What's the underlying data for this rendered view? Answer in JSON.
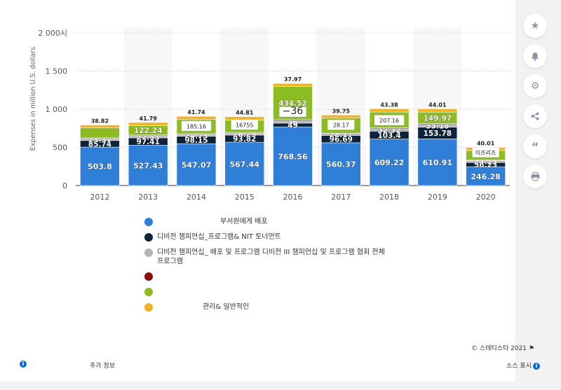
{
  "chart_data": {
    "type": "bar",
    "stacked": true,
    "ylabel": "Expenses in million U.S. dollars",
    "yticks": [
      "0",
      "500",
      "1 000",
      "1 500",
      "2 000시"
    ],
    "ylim": [
      0,
      2000
    ],
    "categories": [
      "2012",
      "2013",
      "2014",
      "2015",
      "2016",
      "2017",
      "2018",
      "2019",
      "2020"
    ],
    "series": [
      {
        "name": "부서원에게 배포",
        "color": "#2f7ed8",
        "values": [
          503.8,
          527.43,
          547.07,
          567.44,
          768.56,
          560.37,
          609.22,
          610.91,
          246.28
        ],
        "labels": [
          "503.8",
          "527.43",
          "547.07",
          "567.44",
          "768.56",
          "560.37",
          "609.22",
          "610.91",
          "246.28"
        ]
      },
      {
        "name": "디비전 챔피언십_프로그램& NIT 토너먼트",
        "color": "#0d233a",
        "values": [
          85.74,
          97.41,
          98.15,
          93.82,
          49,
          96.69,
          103.4,
          153.78,
          56.23
        ],
        "labels": [
          "85.74",
          "97.41",
          "98.15",
          "93.82",
          "49",
          "96.69",
          "103.4",
          "153.78",
          "56.23"
        ]
      },
      {
        "name": "디비전 챔피언십_ 배포 및 프로그램 디비전 III 챔피언십 및 프로그램 협회 전체 프로그램",
        "color": "#b5b5b5",
        "values": [
          25.37,
          27.53,
          24.73,
          26.29,
          36,
          28.17,
          32.32,
          35.18,
          24.23
        ],
        "labels": [
          "25.37",
          "27.53",
          "24.73",
          "26.29",
          "36",
          "28.17",
          "32.32",
          "35.18",
          "24.23"
        ]
      },
      {
        "name": "",
        "color": "#8b0e0e",
        "values": [
          10,
          10,
          10,
          10,
          12,
          10,
          11,
          12,
          8
        ],
        "labels": []
      },
      {
        "name": "",
        "color": "#8bbc21",
        "values": [
          130,
          122.24,
          185.16,
          160,
          434.52,
          188.9,
          207.16,
          149.97,
          125
        ],
        "labels": [
          "",
          "122.24",
          "",
          "",
          "434.52",
          "188.9",
          "",
          "149.97",
          ""
        ]
      },
      {
        "name": "관리& 일반적인",
        "color": "#f0b323",
        "values": [
          38.82,
          41.79,
          41.74,
          44.81,
          37.97,
          39.75,
          43.38,
          44.01,
          40.01
        ],
        "labels": [
          "38.82",
          "41.79",
          "41.74",
          "44.81",
          "37.97",
          "39.75",
          "43.38",
          "44.01",
          "40.01"
        ]
      }
    ],
    "boxed_labels": [
      {
        "category": "2014",
        "text": "185.16"
      },
      {
        "category": "2015",
        "text": "16755"
      },
      {
        "category": "2016",
        "text": "−36"
      },
      {
        "category": "2017",
        "text": "28.17"
      },
      {
        "category": "2018",
        "text": "207.16"
      },
      {
        "category": "2020",
        "text": "이즈리즈"
      }
    ],
    "grid": true,
    "legend_position": "bottom"
  },
  "legend": [
    {
      "label": "부서원에게 배포",
      "color": "#2f7ed8"
    },
    {
      "label": "디비전 챔피언십_프로그램&                                NIT 토너먼트",
      "color": "#0d233a"
    },
    {
      "label": "디비전 챔피언십_ 배포 및 프로그램 디비전 III 챔피언십 및 프로그램 협회 전체 프로그램",
      "color": "#b5b5b5"
    },
    {
      "label": "",
      "color": "#8b0e0e"
    },
    {
      "label": "",
      "color": "#8bbc21"
    },
    {
      "label": "관리& 일반적인",
      "color": "#f0b323"
    }
  ],
  "footer": {
    "more_info": "추가 정보",
    "copyright": "© 스테티스타 2021",
    "source": "소스 표시"
  },
  "sidebar_icons": [
    "star-icon",
    "bell-icon",
    "gear-icon",
    "share-icon",
    "quote-icon",
    "print-icon"
  ]
}
